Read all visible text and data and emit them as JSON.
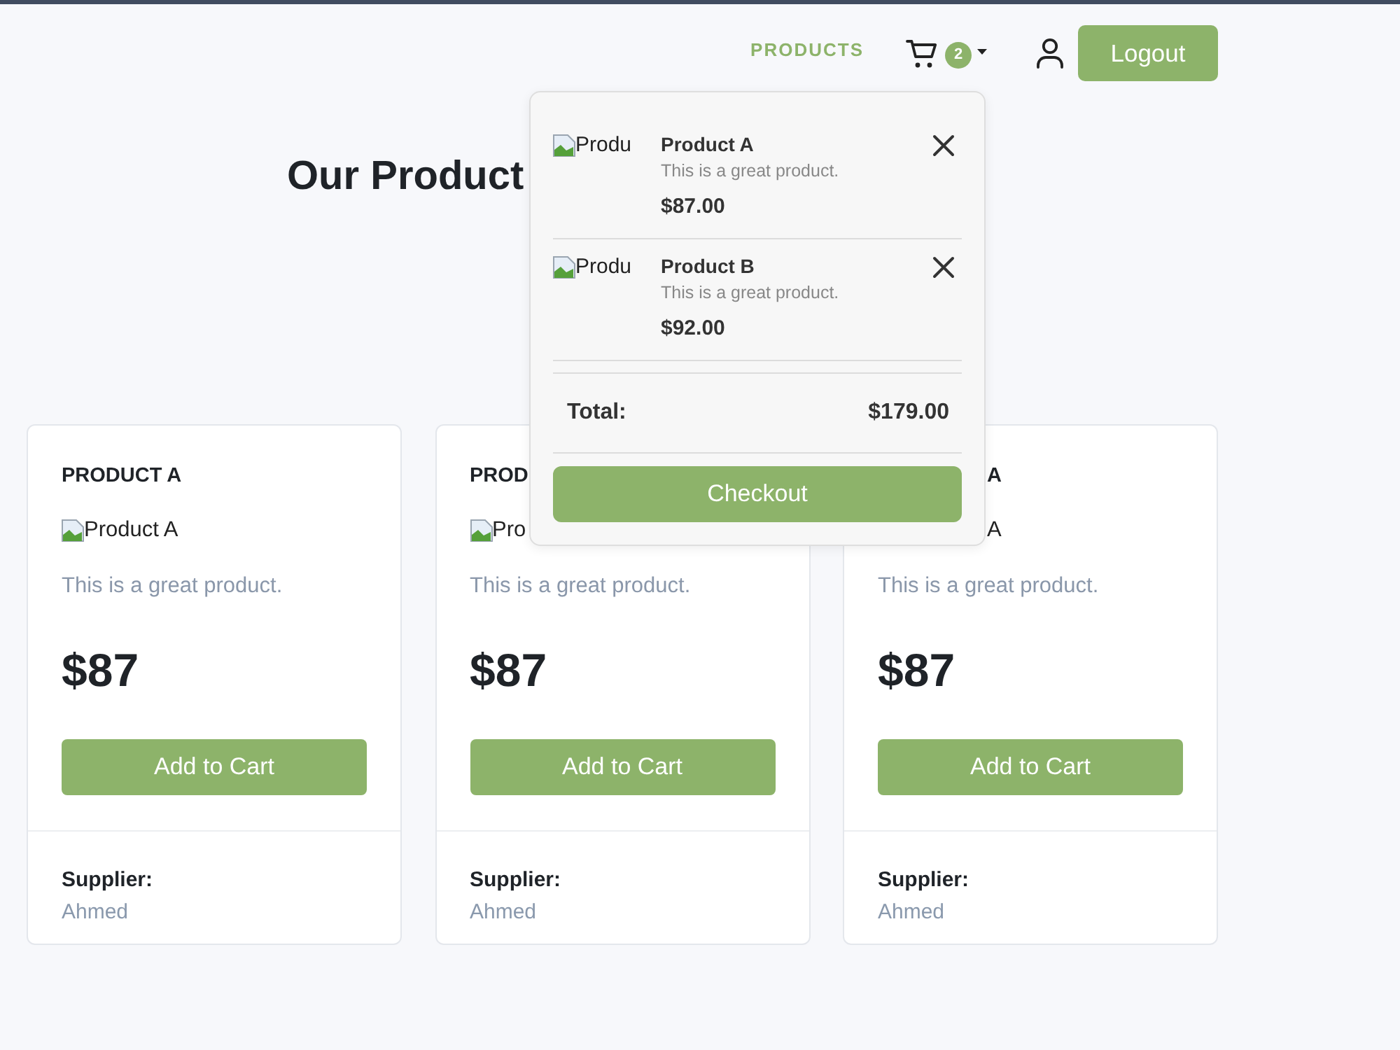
{
  "nav": {
    "links": [
      "PRODUCTS"
    ],
    "cart_count": "2",
    "logout": "Logout"
  },
  "heading": "Our Product",
  "products": [
    {
      "title": "PRODUCT A",
      "image_alt": "Product A",
      "description": "This is a great product.",
      "price": "$87",
      "button": "Add to Cart",
      "supplier_label": "Supplier:",
      "supplier": "Ahmed"
    },
    {
      "title": "PROD",
      "image_alt": "Pro",
      "description": "This is a great product.",
      "price": "$87",
      "button": "Add to Cart",
      "supplier_label": "Supplier:",
      "supplier": "Ahmed"
    },
    {
      "title": "A",
      "image_alt": "A",
      "description": "This is a great product.",
      "price": "$87",
      "button": "Add to Cart",
      "supplier_label": "Supplier:",
      "supplier": "Ahmed"
    }
  ],
  "cart_dropdown": {
    "items": [
      {
        "image_alt": "Produ",
        "name": "Product A",
        "description": "This is a great product.",
        "price": "$87.00"
      },
      {
        "image_alt": "Produ",
        "name": "Product B",
        "description": "This is a great product.",
        "price": "$92.00"
      }
    ],
    "total_label": "Total:",
    "total": "$179.00",
    "checkout": "Checkout"
  }
}
